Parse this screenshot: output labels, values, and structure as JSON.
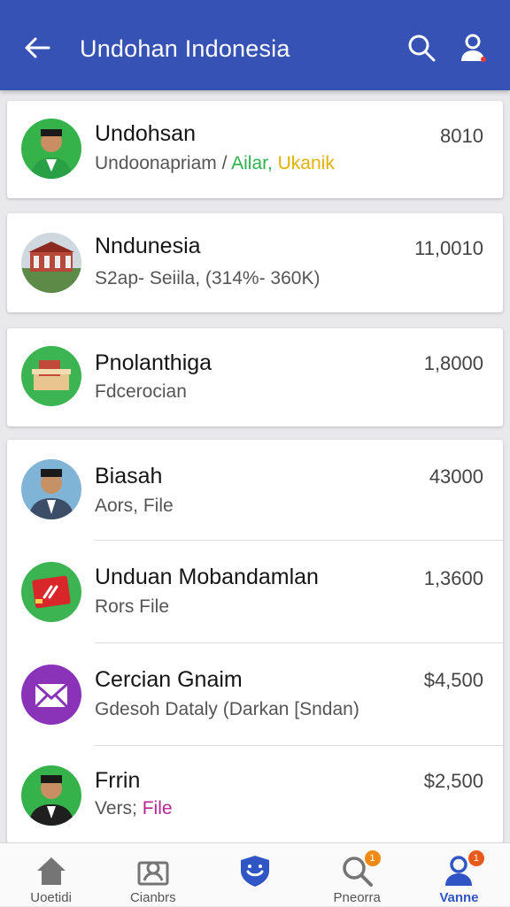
{
  "app_bar": {
    "title": "Undohan Indonesia"
  },
  "items": [
    {
      "name": "Undohsan",
      "sub_parts": [
        "Undoonapriam / ",
        "Ailar,",
        " Ukanik"
      ],
      "amount": "8010"
    },
    {
      "name": "Nndunesia",
      "sub": "S2ap- Seiila, (314%- 360K)",
      "amount": "11,0010"
    },
    {
      "name": "Pnolanthiga",
      "sub": "Fdcerocian",
      "amount": "1,8000"
    },
    {
      "name": "Biasah",
      "sub": "Aors, File",
      "amount": "43000"
    },
    {
      "name": "Unduan Mobandamlan",
      "sub": "Rors File",
      "amount": "1,3600"
    },
    {
      "name": "Cercian Gnaim",
      "sub": "Gdesoh Dataly (Darkan [Sndan)",
      "amount": "$4,500"
    },
    {
      "name": "Frrin",
      "sub_parts": [
        "Vers; ",
        "File"
      ],
      "amount": "$2,500"
    }
  ],
  "bottom_nav": [
    {
      "label": "Uoetidi",
      "icon": "home-icon"
    },
    {
      "label": "Cianbrs",
      "icon": "id-card-icon"
    },
    {
      "label": "",
      "icon": "shield-icon"
    },
    {
      "label": "Pneorra",
      "icon": "search-icon",
      "badge": "1"
    },
    {
      "label": "Vanne",
      "icon": "user-icon",
      "badge": "1",
      "active": true
    }
  ],
  "colors": {
    "app_bar": "#3552b4",
    "accent": "#2f56c4",
    "green_text": "#2bb24c",
    "yellow_text": "#e2b100",
    "magenta_text": "#b8268e",
    "badge": "#f08a16"
  }
}
